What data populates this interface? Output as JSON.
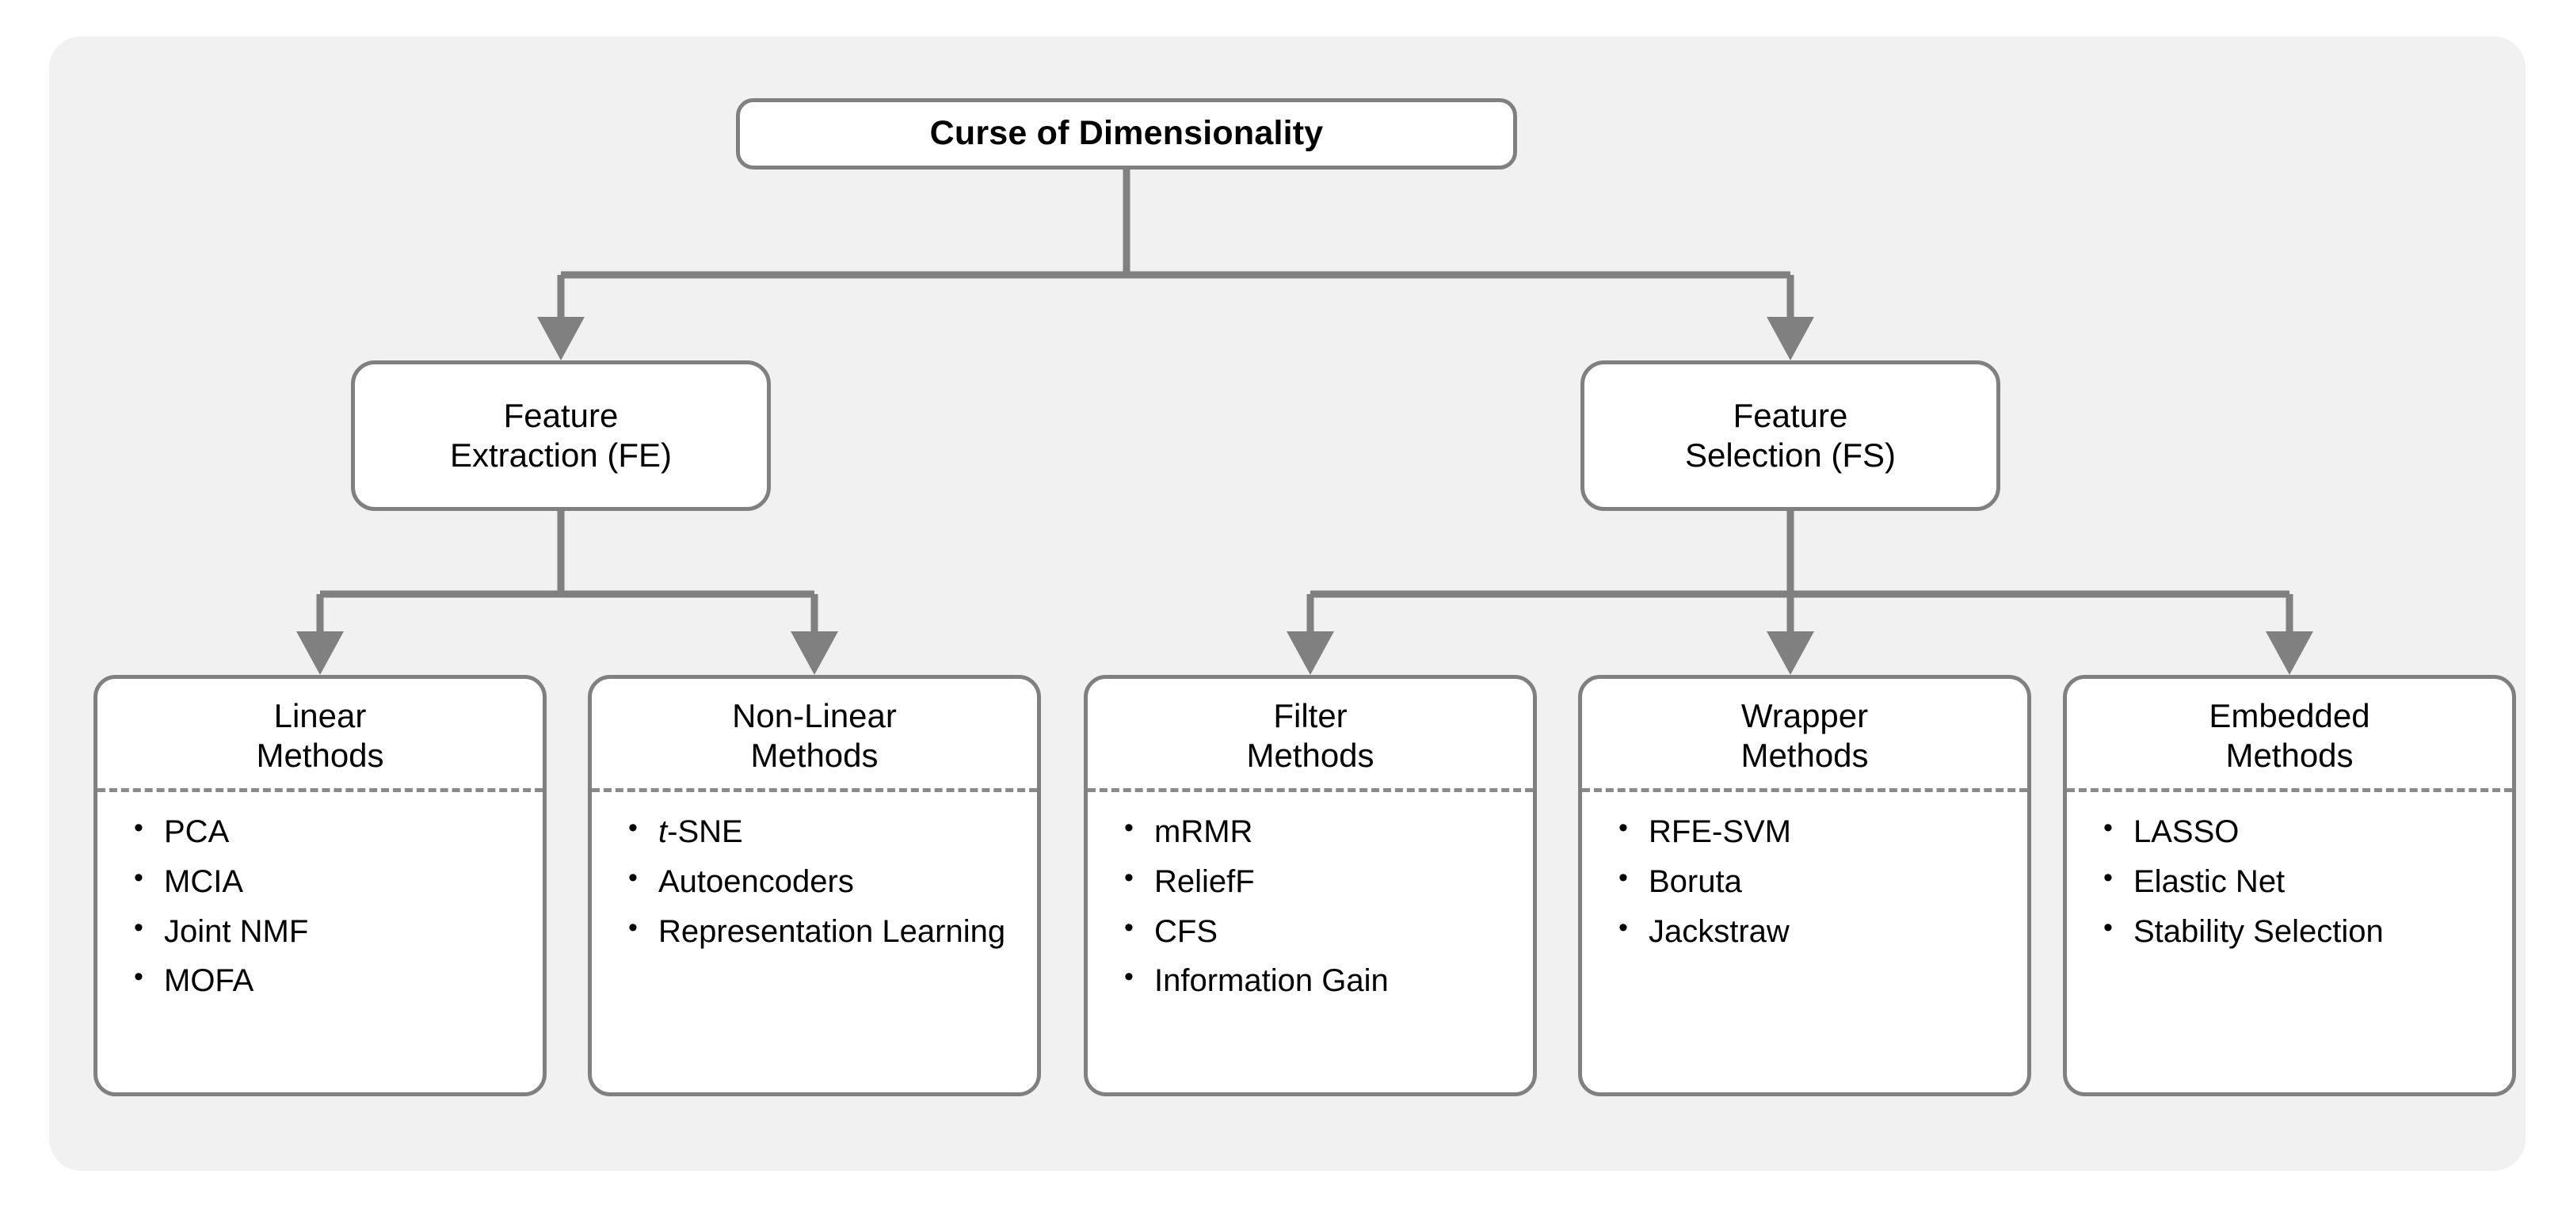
{
  "diagram": {
    "title": "Curse of Dimensionality",
    "panel_color": "#f1f1f1",
    "node_border_color": "#808080",
    "node_fill_color": "#ffffff",
    "connector_color": "#808080",
    "separator_color": "#8a8a8a",
    "text_color": "#000000"
  },
  "root": {
    "label": "Curse of Dimensionality"
  },
  "level2": {
    "fe": {
      "label": "Feature\nExtraction (FE)"
    },
    "fs": {
      "label": "Feature\nSelection (FS)"
    }
  },
  "leaves": {
    "linear": {
      "title": "Linear\nMethods",
      "items": [
        "PCA",
        "MCIA",
        "Joint NMF",
        "MOFA"
      ]
    },
    "nonlinear": {
      "title": "Non-Linear\nMethods",
      "items": [
        "t-SNE",
        "Autoencoders",
        "Representation Learning"
      ],
      "items_html": [
        "<em>t</em>-SNE",
        "Autoencoders",
        "Representation Learning"
      ]
    },
    "filter": {
      "title": "Filter\nMethods",
      "items": [
        "mRMR",
        "ReliefF",
        "CFS",
        "Information Gain"
      ]
    },
    "wrapper": {
      "title": "Wrapper\nMethods",
      "items": [
        "RFE-SVM",
        "Boruta",
        "Jackstraw"
      ]
    },
    "embedded": {
      "title": "Embedded\nMethods",
      "items": [
        "LASSO",
        "Elastic Net",
        "Stability Selection"
      ]
    }
  }
}
